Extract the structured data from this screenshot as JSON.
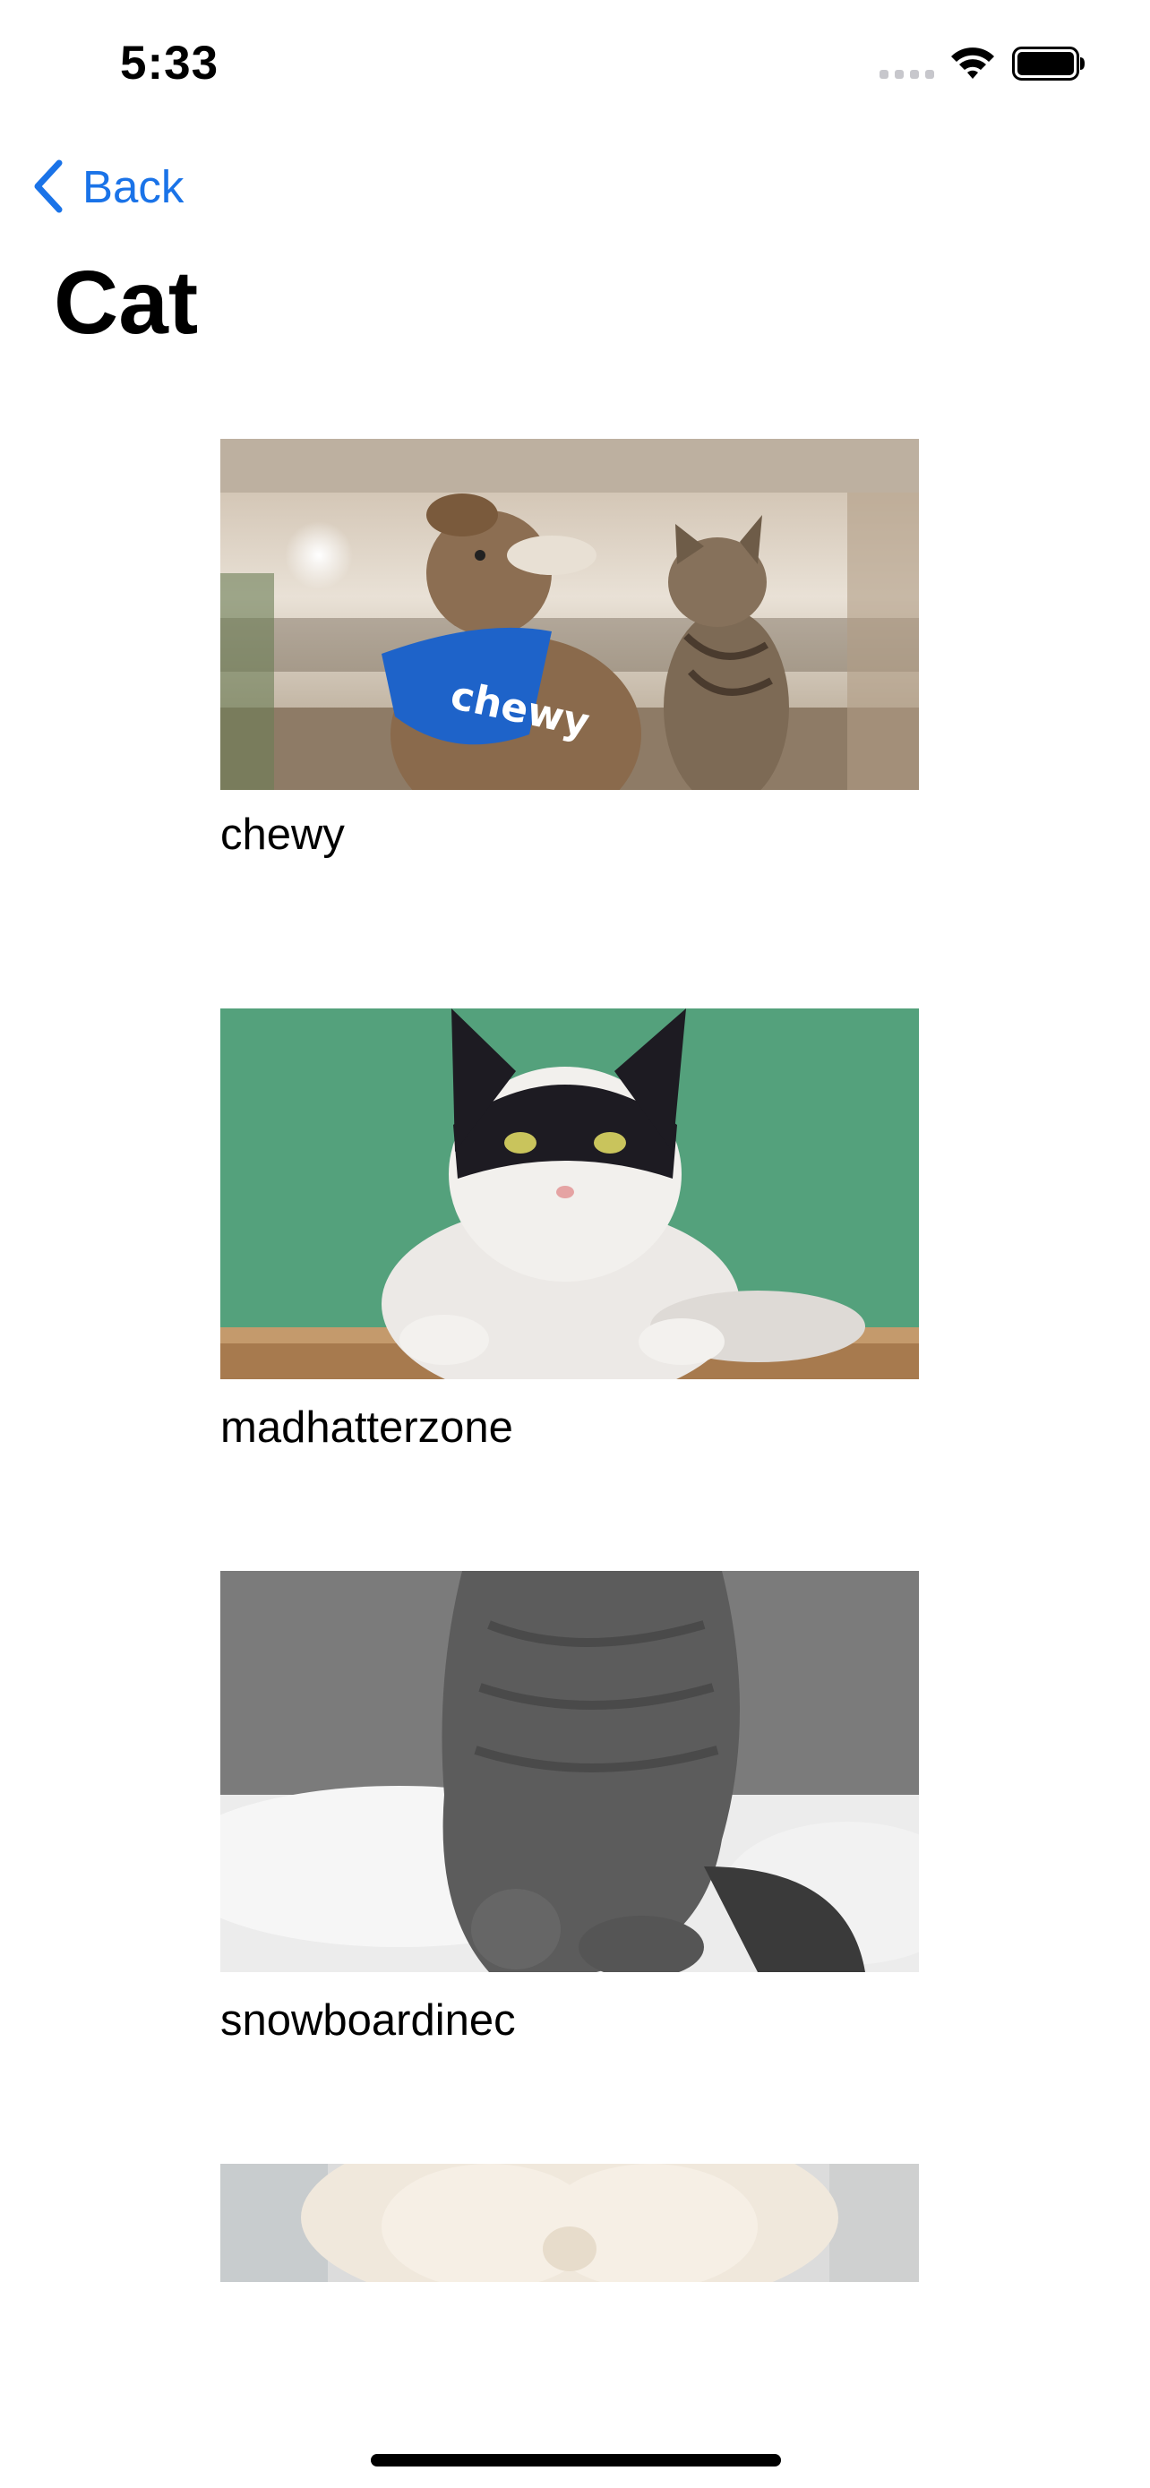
{
  "status_bar": {
    "time": "5:33",
    "icons": [
      "cellular-signal-icon",
      "wifi-icon",
      "battery-icon"
    ]
  },
  "navigation": {
    "back_label": "Back",
    "title": "Cat",
    "accent_color": "#1a73e8"
  },
  "posts": [
    {
      "username": "chewy",
      "image": "dog-and-cat-photo"
    },
    {
      "username": "madhatterzone",
      "image": "black-and-white-cat-photo"
    },
    {
      "username": "snowboardinec",
      "image": "gray-cat-photo"
    },
    {
      "username": "",
      "image": "white-fluffy-cat-photo"
    }
  ],
  "images": {
    "post1_bandana_text": "chewy"
  }
}
